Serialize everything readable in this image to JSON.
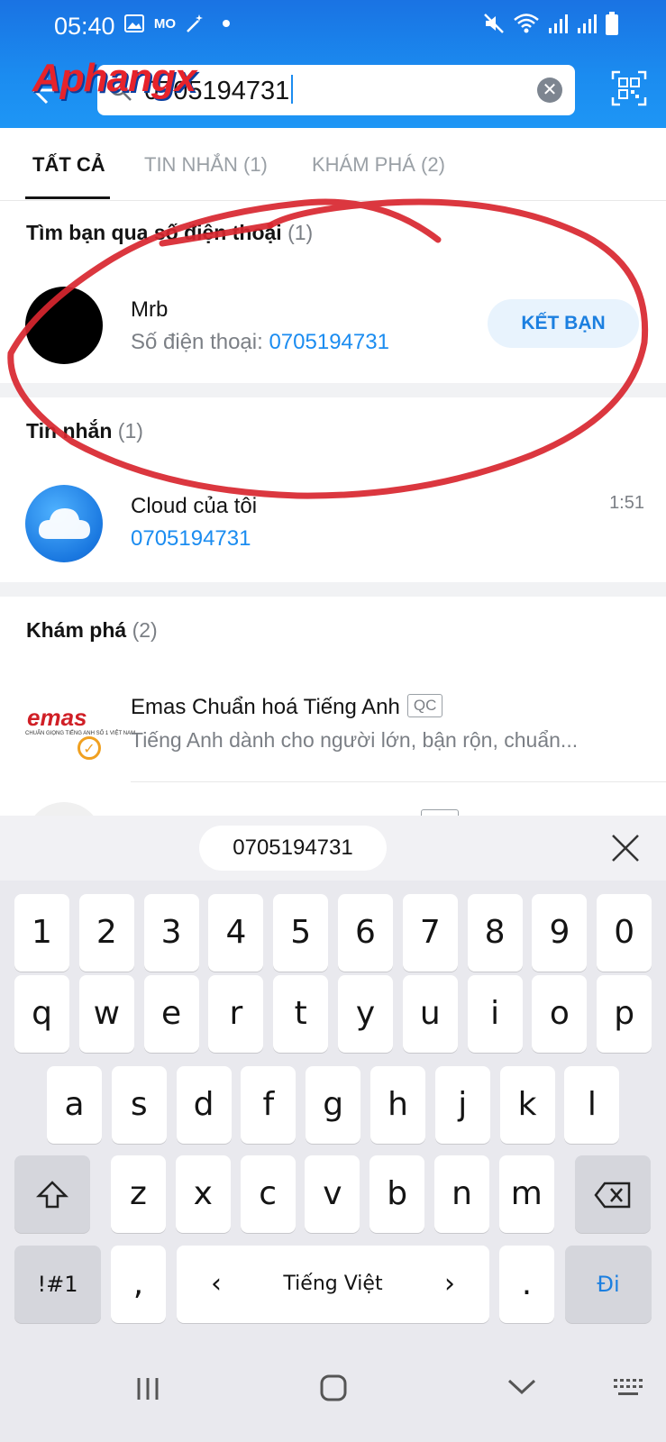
{
  "status_bar": {
    "time": "05:40",
    "left_icons": [
      "image-icon",
      "mo-mo-icon",
      "magic-wand-icon",
      "dot-icon"
    ],
    "right_icons": [
      "mute-icon",
      "wifi-icon",
      "signal-icon",
      "signal-icon",
      "battery-icon"
    ],
    "mo_label": "MO"
  },
  "watermark": {
    "text": "Aphangx"
  },
  "search": {
    "value": "0705194731",
    "clear_symbol": "✕"
  },
  "tabs": [
    {
      "label": "TẤT CẢ",
      "active": true
    },
    {
      "label": "TIN NHẮN (1)",
      "active": false
    },
    {
      "label": "KHÁM PHÁ (2)",
      "active": false
    }
  ],
  "phone_section": {
    "title": "Tìm bạn qua số điện thoại",
    "count": "(1)",
    "result": {
      "name": "Mrb",
      "sub_prefix": "Số điện thoại: ",
      "phone": "0705194731",
      "action_label": "KẾT BẠN"
    }
  },
  "messages_section": {
    "title": "Tin nhắn",
    "count": "(1)",
    "item": {
      "name": "Cloud của tôi",
      "snippet": "0705194731",
      "time": "1:51"
    }
  },
  "discover_section": {
    "title": "Khám phá",
    "count": "(2)",
    "item": {
      "logo_text": "emas",
      "logo_tagline": "CHUẨN GIỌNG TIẾNG ANH SỐ 1 VIỆT NAM",
      "name": "Emas Chuẩn hoá Tiếng Anh",
      "badge": "QC",
      "description": "Tiếng Anh dành cho người lớn, bận rộn, chuẩn..."
    }
  },
  "keyboard": {
    "suggestion": "0705194731",
    "row_numbers": [
      "1",
      "2",
      "3",
      "4",
      "5",
      "6",
      "7",
      "8",
      "9",
      "0"
    ],
    "row_top": [
      "q",
      "w",
      "e",
      "r",
      "t",
      "y",
      "u",
      "i",
      "o",
      "p"
    ],
    "row_middle": [
      "a",
      "s",
      "d",
      "f",
      "g",
      "h",
      "j",
      "k",
      "l"
    ],
    "row_bottom": [
      "z",
      "x",
      "c",
      "v",
      "b",
      "n",
      "m"
    ],
    "symbols_key": "!#1",
    "comma_key": ",",
    "language": "Tiếng Việt",
    "lang_prev": "‹",
    "lang_next": "›",
    "period_key": ".",
    "enter_key": "Đi",
    "accent_color": "#1b7fe0"
  },
  "nav_bar": {
    "icons": [
      "recent-apps-icon",
      "home-icon",
      "back-icon",
      "keyboard-icon"
    ]
  },
  "colors": {
    "header": "#1b8cf0",
    "annotation": "#d8262f",
    "link": "#1b8cf0"
  }
}
